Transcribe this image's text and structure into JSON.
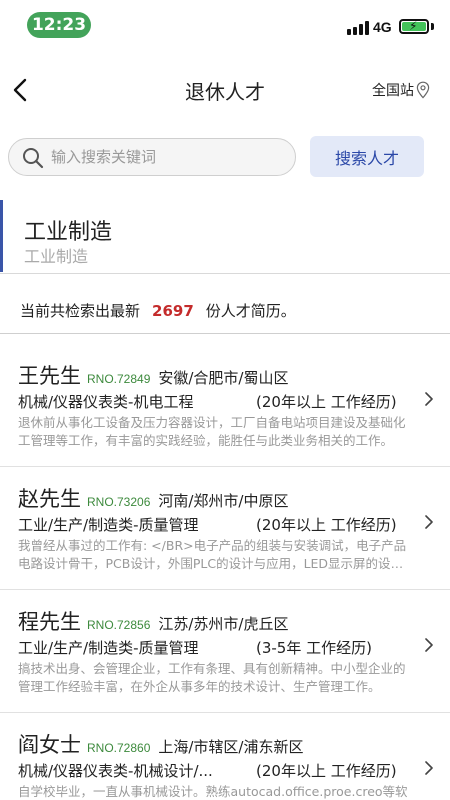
{
  "status_bar": {
    "time": "12:23",
    "network": "4G",
    "time_pill_color": "#43a35a",
    "battery_icon": "battery-charging-icon",
    "signal_icon": "signal-bars-icon"
  },
  "header": {
    "title": "退休人才",
    "region_label": "全国站",
    "back_icon": "chevron-left-icon",
    "region_icon": "location-pin-icon"
  },
  "search": {
    "placeholder": "输入搜索关键词",
    "value": "",
    "button_label": "搜索人才",
    "icon": "search-icon",
    "button_color": "#e3e9f8"
  },
  "category": {
    "title": "工业制造",
    "subtitle": "工业制造",
    "accent_color": "#3a55a8"
  },
  "results": {
    "prefix": "当前共检索出最新",
    "count": "2697",
    "suffix": "份人才简历。",
    "count_color": "#c42b2b"
  },
  "talents": [
    {
      "name": "王先生",
      "rno": "RNO.72849",
      "location": "安徽/合肥市/蜀山区",
      "job": "机械/仪器仪表类-机电工程",
      "experience": "(20年以上 工作经历)",
      "description": "退休前从事化工设备及压力容器设计，工厂自备电站项目建设及基础化工管理等工作，有丰富的实践经验，能胜任与此类业务相关的工作。"
    },
    {
      "name": "赵先生",
      "rno": "RNO.73206",
      "location": "河南/郑州市/中原区",
      "job": "工业/生产/制造类-质量管理",
      "experience": "(20年以上 工作经历)",
      "description": "我曾经从事过的工作有: </BR>电子产品的组装与安装调试，电子产品电路设计骨干，PCB设计，外围PLC的设计与应用，LED显示屏的设计制作。"
    },
    {
      "name": "程先生",
      "rno": "RNO.72856",
      "location": "江苏/苏州市/虎丘区",
      "job": "工业/生产/制造类-质量管理",
      "experience": "(3-5年 工作经历)",
      "description": "搞技术出身、会管理企业，工作有条理、具有创新精神。中小型企业的管理工作经验丰富，在外企从事多年的技术设计、生产管理工作。"
    },
    {
      "name": "阎女士",
      "rno": "RNO.72860",
      "location": "上海/市辖区/浦东新区",
      "job": "机械/仪器仪表类-机械设计/...",
      "experience": "(20年以上 工作经历)",
      "description": "自学校毕业，一直从事机械设计。熟练autocad.office.proe.creo等软件。"
    }
  ]
}
